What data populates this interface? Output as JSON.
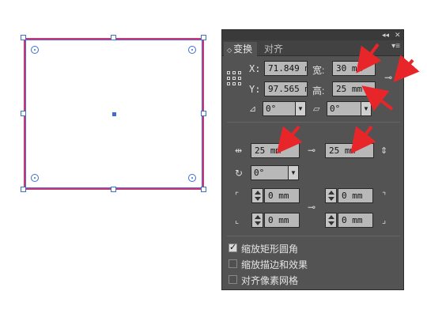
{
  "panel": {
    "tabs": [
      {
        "label": "变换",
        "active": true
      },
      {
        "label": "对齐",
        "active": false
      }
    ],
    "topbar": {
      "collapse": "◂◂",
      "close": "✕"
    },
    "menu_icon": "panel-menu-icon",
    "x": {
      "label": "X:",
      "value": "71.849 mm"
    },
    "y": {
      "label": "Y:",
      "value": "97.565 mm"
    },
    "width": {
      "label": "宽:",
      "value": "30 mm"
    },
    "height": {
      "label": "高:",
      "value": "25 mm"
    },
    "rotate": {
      "value": "0°"
    },
    "shear": {
      "value": "0°"
    },
    "rect_width": {
      "value": "25 mm"
    },
    "rect_height": {
      "value": "25 mm"
    },
    "rect_rotate": {
      "value": "0°"
    },
    "corners": {
      "top_left": "0 mm",
      "top_right": "0 mm",
      "bottom_left": "0 mm",
      "bottom_right": "0 mm"
    },
    "options": [
      {
        "label": "缩放矩形圆角",
        "checked": true
      },
      {
        "label": "缩放描边和效果",
        "checked": false
      },
      {
        "label": "对齐像素网格",
        "checked": false
      }
    ]
  },
  "colors": {
    "panel_bg": "#535353",
    "selection_outline": "#c23b7a",
    "handle_blue": "#3b6ed6",
    "annotation_red": "#e8262a"
  }
}
